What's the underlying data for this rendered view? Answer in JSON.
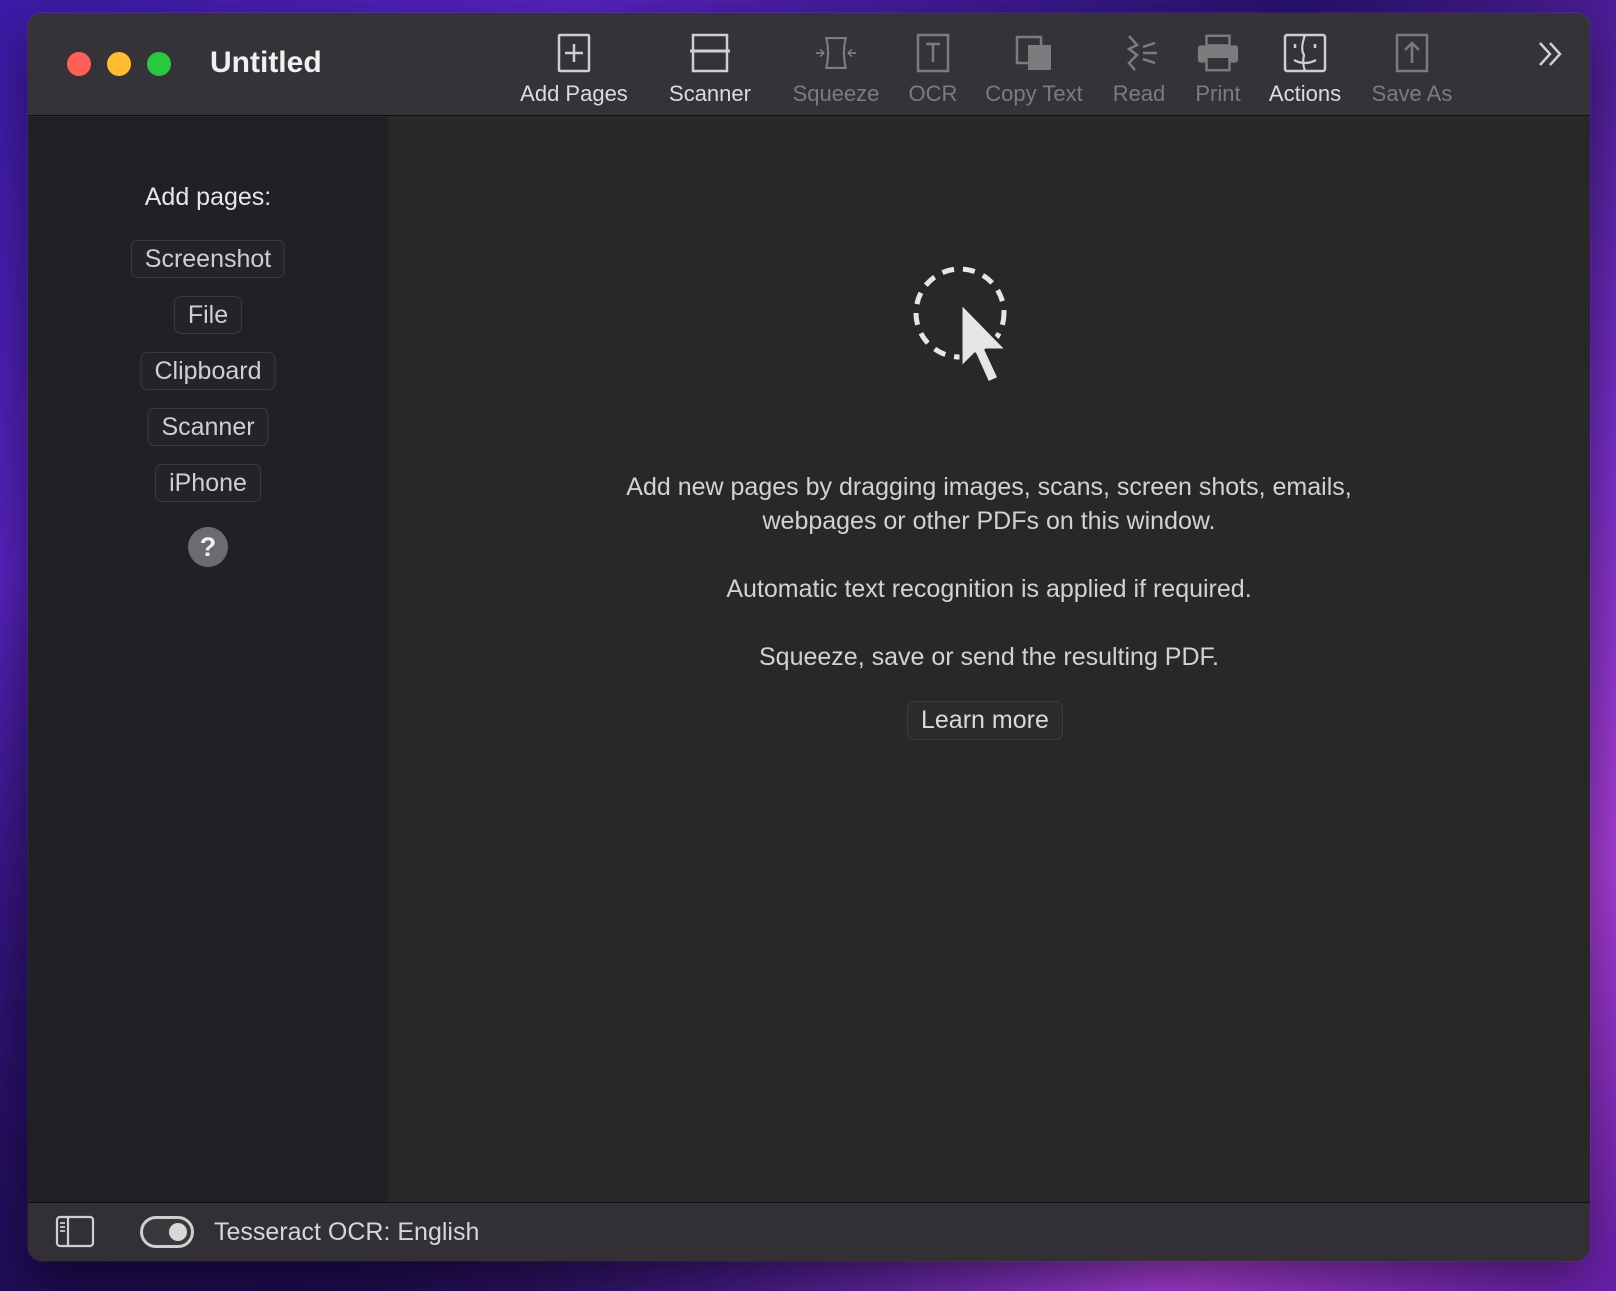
{
  "window": {
    "title": "Untitled"
  },
  "toolbar": {
    "buttons": [
      {
        "label": "Add Pages",
        "icon": "add-page-icon",
        "enabled": true
      },
      {
        "label": "Scanner",
        "icon": "scanner-icon",
        "enabled": true
      },
      {
        "label": "Squeeze",
        "icon": "squeeze-icon",
        "enabled": false
      },
      {
        "label": "OCR",
        "icon": "ocr-icon",
        "enabled": false
      },
      {
        "label": "Copy Text",
        "icon": "copy-icon",
        "enabled": false
      },
      {
        "label": "Read",
        "icon": "speech-icon",
        "enabled": false
      },
      {
        "label": "Print",
        "icon": "printer-icon",
        "enabled": false
      },
      {
        "label": "Actions",
        "icon": "finder-icon",
        "enabled": true
      },
      {
        "label": "Save As",
        "icon": "share-icon",
        "enabled": false
      }
    ],
    "overflow_icon": "double-chevron-right-icon"
  },
  "sidebar": {
    "heading": "Add pages:",
    "items": [
      {
        "label": "Screenshot"
      },
      {
        "label": "File"
      },
      {
        "label": "Clipboard"
      },
      {
        "label": "Scanner"
      },
      {
        "label": "iPhone"
      }
    ],
    "help_label": "?"
  },
  "main": {
    "drop_icon": "dashed-circle-cursor-icon",
    "message_line1": "Add new pages by dragging images, scans, screen shots, emails,",
    "message_line2": "webpages or other PDFs on this window.",
    "message_ocr": "Automatic text recognition is applied if required.",
    "message_squeeze": "Squeeze, save or send the resulting PDF.",
    "learn_more_label": "Learn more"
  },
  "statusbar": {
    "ocr_status": "Tesseract OCR: English",
    "ocr_toggle_on": true
  },
  "colors": {
    "close": "#ff5f57",
    "minimize": "#febc2e",
    "maximize": "#28c840",
    "sidebar_bg": "#222027",
    "main_bg": "#282828"
  }
}
